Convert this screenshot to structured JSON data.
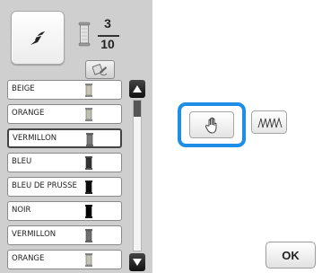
{
  "header": {
    "preview_icon": "embroidery-pattern-icon",
    "spool_icon": "thread-spool-icon",
    "current_color": "3",
    "total_colors": "10",
    "thread_icon": "thread-change-icon"
  },
  "thread_list": {
    "items": [
      {
        "name": "BEIGE",
        "color": "#c9c4b4",
        "selected": false
      },
      {
        "name": "ORANGE",
        "color": "#c0c0b0",
        "selected": false
      },
      {
        "name": "VERMILLON",
        "color": "#7a7a7a",
        "selected": true
      },
      {
        "name": "BLEU",
        "color": "#333333",
        "selected": false
      },
      {
        "name": "BLEU DE PRUSSE",
        "color": "#0c0c0c",
        "selected": false
      },
      {
        "name": "NOIR",
        "color": "#000000",
        "selected": false
      },
      {
        "name": "VERMILLON",
        "color": "#6f6f6f",
        "selected": false
      },
      {
        "name": "ORANGE",
        "color": "#c4c4b6",
        "selected": false
      }
    ],
    "scroll_up_icon": "arrow-up-icon",
    "scroll_down_icon": "arrow-down-icon"
  },
  "controls": {
    "hand_icon": "hand-icon",
    "stitch_icon": "stitch-pattern-icon",
    "ok_label": "OK"
  },
  "colors": {
    "focus_ring": "#1e8ee6",
    "panel": "#cfcfcf"
  }
}
